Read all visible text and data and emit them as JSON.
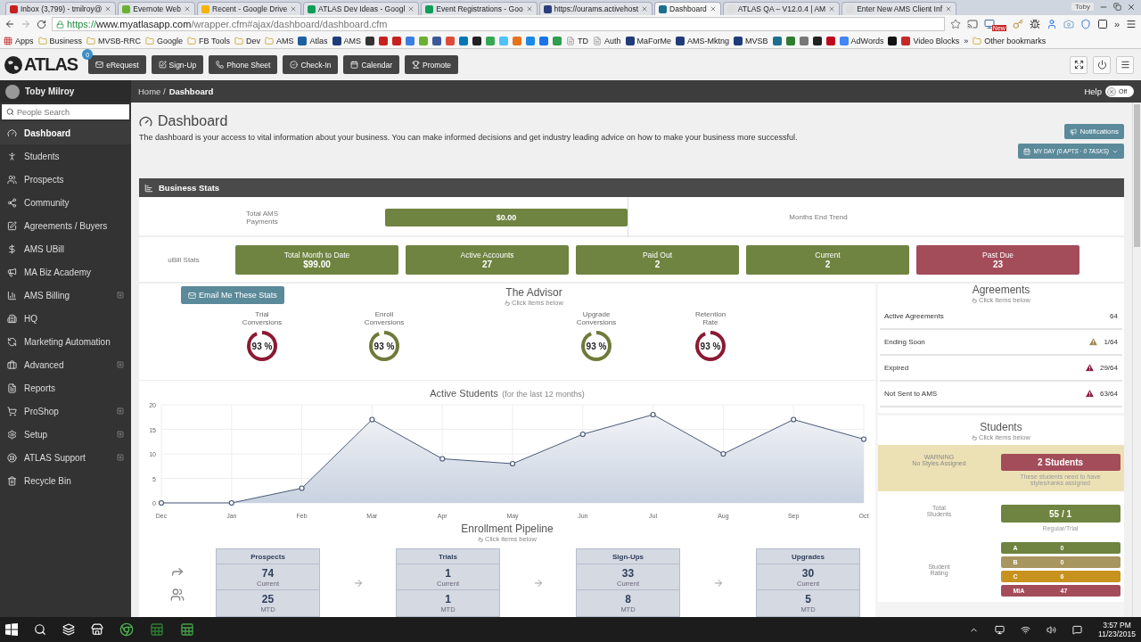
{
  "browser": {
    "tabs": [
      {
        "title": "Inbox (3,799) - tmilroy@",
        "color": "#c5221f",
        "selected": false
      },
      {
        "title": "Evernote Web",
        "color": "#6bb130",
        "selected": false
      },
      {
        "title": "Recent - Google Drive",
        "color": "#f4b400",
        "selected": false
      },
      {
        "title": "ATLAS Dev Ideas - Googl",
        "color": "#0f9d58",
        "selected": false
      },
      {
        "title": "Event Registrations - Goo",
        "color": "#0f9d58",
        "selected": false
      },
      {
        "title": "https://ourams.activehost",
        "color": "#2a3f7a",
        "selected": false
      },
      {
        "title": "Dashboard",
        "color": "#1d6f8f",
        "selected": true
      },
      {
        "title": "ATLAS QA – V12.0.4 | AM",
        "color": "#dddddd",
        "selected": false
      },
      {
        "title": "Enter New AMS Client Inf",
        "color": "#dddddd",
        "selected": false
      }
    ],
    "profile": "Toby",
    "url": {
      "scheme": "https://",
      "host": "www.myatlasapp.com",
      "path": "/wrapper.cfm#ajax/dashboard/dashboard.cfm"
    },
    "extension_badge": "New",
    "extensions_more": "»",
    "bookmarks": [
      {
        "kind": "apps",
        "label": "Apps"
      },
      {
        "kind": "folder",
        "label": "Business"
      },
      {
        "kind": "folder",
        "label": "MVSB-RRC"
      },
      {
        "kind": "folder",
        "label": "Google"
      },
      {
        "kind": "folder",
        "label": "FB Tools"
      },
      {
        "kind": "folder",
        "label": "Dev"
      },
      {
        "kind": "folder",
        "label": "AMS"
      },
      {
        "kind": "site",
        "label": "Atlas",
        "color": "#1d5f9f"
      },
      {
        "kind": "site",
        "label": "AMS",
        "color": "#1f3b7a"
      },
      {
        "kind": "icon",
        "color": "#333333"
      },
      {
        "kind": "icon",
        "color": "#c5221f"
      },
      {
        "kind": "icon",
        "color": "#c5221f"
      },
      {
        "kind": "icon",
        "color": "#3b7de0"
      },
      {
        "kind": "icon",
        "color": "#6bb130"
      },
      {
        "kind": "icon",
        "color": "#3b5998"
      },
      {
        "kind": "icon",
        "color": "#dd4b39"
      },
      {
        "kind": "icon",
        "color": "#0077b5"
      },
      {
        "kind": "icon",
        "color": "#222222"
      },
      {
        "kind": "icon",
        "color": "#34a853"
      },
      {
        "kind": "icon",
        "color": "#4fc3f7"
      },
      {
        "kind": "icon",
        "color": "#e8711c"
      },
      {
        "kind": "icon",
        "color": "#1e88e5"
      },
      {
        "kind": "icon",
        "color": "#1a73e8"
      },
      {
        "kind": "icon",
        "color": "#2e9e4f"
      },
      {
        "kind": "page",
        "label": "TD"
      },
      {
        "kind": "page",
        "label": "Auth"
      },
      {
        "kind": "site",
        "label": "MaForMe",
        "color": "#1f3b7a"
      },
      {
        "kind": "site",
        "label": "AMS-Mktng",
        "color": "#1f3b7a"
      },
      {
        "kind": "site",
        "label": "MVSB",
        "color": "#1f3b7a"
      },
      {
        "kind": "icon",
        "color": "#1d6f8f"
      },
      {
        "kind": "icon",
        "color": "#2e7d32"
      },
      {
        "kind": "icon",
        "color": "#777777"
      },
      {
        "kind": "icon",
        "color": "#222222"
      },
      {
        "kind": "icon",
        "color": "#bd081c"
      },
      {
        "kind": "site",
        "label": "AdWords",
        "color": "#4285f4"
      },
      {
        "kind": "icon",
        "color": "#111111"
      },
      {
        "kind": "site",
        "label": "Video Blocks",
        "color": "#c62828"
      }
    ],
    "bookmarks_more": "»",
    "other_bookmarks": "Other bookmarks"
  },
  "app": {
    "logo": "ATLAS",
    "nav": [
      {
        "label": "eRequest",
        "badge": "0"
      },
      {
        "label": "Sign-Up"
      },
      {
        "label": "Phone Sheet"
      },
      {
        "label": "Check-In"
      },
      {
        "label": "Calendar"
      },
      {
        "label": "Promote"
      }
    ]
  },
  "sidebar": {
    "user": "Toby Milroy",
    "search_placeholder": "People Search",
    "items": [
      {
        "label": "Dashboard",
        "selected": true,
        "expandable": false
      },
      {
        "label": "Students",
        "selected": false,
        "expandable": false
      },
      {
        "label": "Prospects",
        "selected": false,
        "expandable": false
      },
      {
        "label": "Community",
        "selected": false,
        "expandable": false
      },
      {
        "label": "Agreements / Buyers",
        "selected": false,
        "expandable": false
      },
      {
        "label": "AMS UBill",
        "selected": false,
        "expandable": false
      },
      {
        "label": "MA Biz Academy",
        "selected": false,
        "expandable": false
      },
      {
        "label": "AMS Billing",
        "selected": false,
        "expandable": true
      },
      {
        "label": "HQ",
        "selected": false,
        "expandable": false
      },
      {
        "label": "Marketing Automation",
        "selected": false,
        "expandable": false
      },
      {
        "label": "Advanced",
        "selected": false,
        "expandable": true
      },
      {
        "label": "Reports",
        "selected": false,
        "expandable": false
      },
      {
        "label": "ProShop",
        "selected": false,
        "expandable": true
      },
      {
        "label": "Setup",
        "selected": false,
        "expandable": true
      },
      {
        "label": "ATLAS Support",
        "selected": false,
        "expandable": true
      },
      {
        "label": "Recycle Bin",
        "selected": false,
        "expandable": false
      }
    ]
  },
  "breadcrumb": [
    "Home /",
    "Dashboard"
  ],
  "help": {
    "label": "Help",
    "on": false,
    "state_label": "Off"
  },
  "page": {
    "title": "Dashboard",
    "description": "The dashboard is your access to vital information about your business. You can make informed decisions and get industry leading advice on how to make your business more successful.",
    "notifications": "Notifications",
    "my_day": "MY DAY *(0 APTS · 0 TASKS)*"
  },
  "business_stats": {
    "title": "Business Stats",
    "payments_label": "Total AMS Payments",
    "payments_value": "$0.00",
    "trend_label": "Months End Trend",
    "ubill_label": "uBill Stats",
    "tiles": [
      {
        "label": "Total Month to Date",
        "value": "$99.00",
        "color": "#6f8440"
      },
      {
        "label": "Active Accounts",
        "value": "27",
        "color": "#6f8440"
      },
      {
        "label": "Paid Out",
        "value": "2",
        "color": "#6f8440"
      },
      {
        "label": "Current",
        "value": "2",
        "color": "#6f8440"
      },
      {
        "label": "Past Due",
        "value": "23",
        "color": "#a34c5a"
      }
    ]
  },
  "advisor": {
    "email_button": "Email Me These Stats",
    "title": "The Advisor",
    "hint": "Click items below",
    "gauges": [
      {
        "label": "Trial Conversions",
        "value": "93 %",
        "level": 0.93,
        "color": "#8b1a33"
      },
      {
        "label": "Enroll Conversions",
        "value": "93 %",
        "level": 0.93,
        "color": "#6f7a3a"
      },
      {
        "label": "Upgrade Conversions",
        "value": "93 %",
        "level": 0.93,
        "color": "#6f7a3a"
      },
      {
        "label": "Retention Rate",
        "value": "93 %",
        "level": 0.93,
        "color": "#8b1a33"
      }
    ]
  },
  "active_students": {
    "title": "Active Students",
    "subtitle": "(for the last 12 months)",
    "chart_data": {
      "type": "area",
      "categories": [
        "Dec",
        "Jan",
        "Feb",
        "Mar",
        "Apr",
        "May",
        "Jun",
        "Jul",
        "Aug",
        "Sep",
        "Oct"
      ],
      "series": [
        {
          "color": "#4a5a78",
          "values": [
            0,
            0,
            3,
            17,
            9,
            8,
            14,
            18,
            10,
            17,
            13
          ]
        }
      ],
      "ylim": [
        0,
        20
      ],
      "yticks": [
        0,
        5,
        10,
        15,
        20
      ],
      "grid": true
    }
  },
  "pipeline": {
    "title": "Enrollment Pipeline",
    "hint": "Click items below",
    "stages": [
      {
        "name": "Prospects",
        "current": "74",
        "current_label": "Current",
        "mtd": "25",
        "mtd_label": "MTD"
      },
      {
        "name": "Trials",
        "current": "1",
        "current_label": "Current",
        "mtd": "1",
        "mtd_label": "MTD"
      },
      {
        "name": "Sign-Ups",
        "current": "33",
        "current_label": "Current",
        "mtd": "8",
        "mtd_label": "MTD"
      },
      {
        "name": "Upgrades",
        "current": "30",
        "current_label": "Current",
        "mtd": "5",
        "mtd_label": "MTD"
      }
    ]
  },
  "agreements": {
    "title": "Agreements",
    "hint": "Click items below",
    "rows": [
      {
        "label": "Active Agreements",
        "value": "64"
      },
      {
        "label": "Ending Soon",
        "value": "1/64",
        "color": "#a08a5a"
      },
      {
        "label": "Expired",
        "value": "29/64",
        "color": "#8b2040"
      },
      {
        "label": "Not Sent to AMS",
        "value": "63/64",
        "color": "#8b2040"
      }
    ]
  },
  "students": {
    "title": "Students",
    "hint": "Click items below",
    "warning": {
      "title": "WARNING",
      "text": "No Styles Assigned",
      "button": "2 Students",
      "note": "These students need to have styles/ranks assigned"
    },
    "total": {
      "label": "Total Students",
      "value": "55 / 1",
      "note": "Regular/Trial"
    },
    "rating": {
      "label": "Student Rating",
      "rows": [
        {
          "grade": "A",
          "count": "0",
          "color": "#6f8440"
        },
        {
          "grade": "B",
          "count": "0",
          "color": "#a89660"
        },
        {
          "grade": "C",
          "count": "6",
          "color": "#c8921e"
        },
        {
          "grade": "MIA",
          "count": "47",
          "color": "#a34c5a"
        }
      ]
    }
  },
  "taskbar": {
    "time": "3:57 PM",
    "date": "11/23/2015"
  }
}
